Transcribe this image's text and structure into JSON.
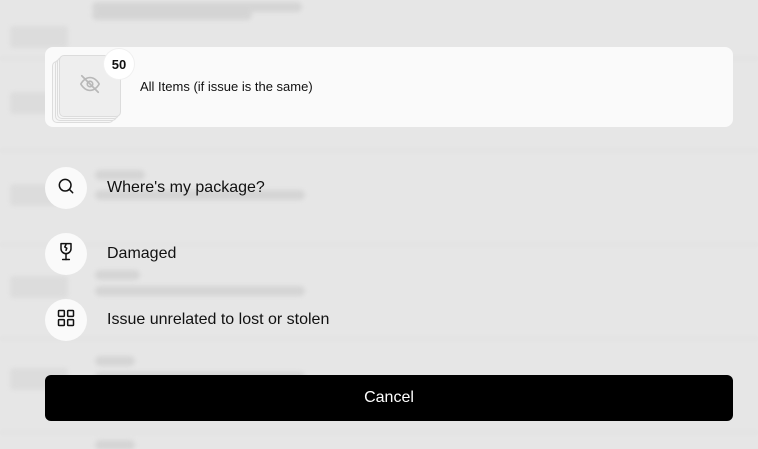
{
  "item_group": {
    "count_badge": "50",
    "label": "All Items (if issue is the same)",
    "thumbnail_icon": "eye-off-icon"
  },
  "options": [
    {
      "label": "Where's my package?",
      "icon": "search-icon"
    },
    {
      "label": "Damaged",
      "icon": "broken-glass-icon"
    },
    {
      "label": "Issue unrelated to lost or stolen",
      "icon": "grid-icon"
    }
  ],
  "actions": {
    "cancel_label": "Cancel"
  }
}
